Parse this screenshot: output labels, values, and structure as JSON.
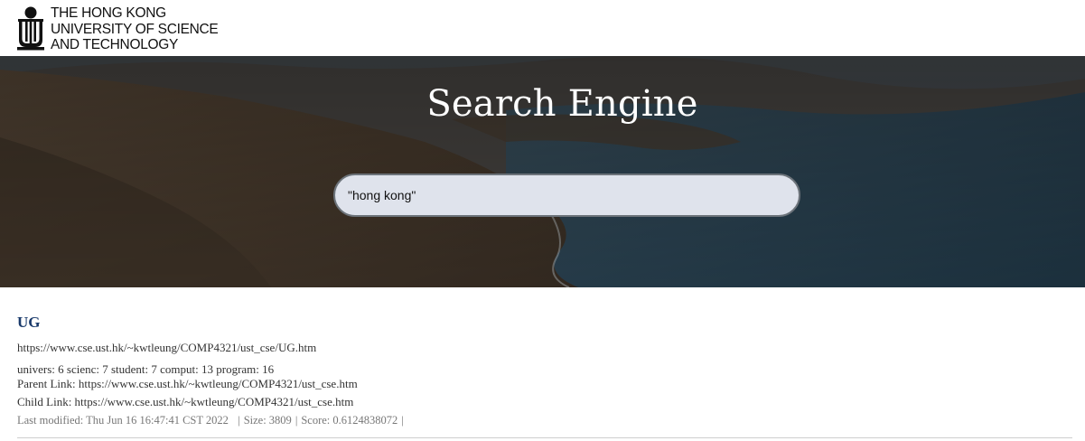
{
  "header": {
    "logo_line1": "THE HONG KONG",
    "logo_line2": "UNIVERSITY OF SCIENCE",
    "logo_line3": "AND TECHNOLOGY"
  },
  "hero": {
    "title": "Search Engine"
  },
  "search": {
    "value": "\"hong kong\""
  },
  "results": [
    {
      "title": "UG",
      "url": "https://www.cse.ust.hk/~kwtleung/COMP4321/ust_cse/UG.htm",
      "keywords": "univers: 6 scienc: 7 student: 7 comput: 13 program: 16",
      "parent_link": "Parent Link: https://www.cse.ust.hk/~kwtleung/COMP4321/ust_cse.htm",
      "child_link": "Child Link: https://www.cse.ust.hk/~kwtleung/COMP4321/ust_cse.htm",
      "last_modified": "Last modified:  Thu Jun 16 16:47:41 CST 2022",
      "size": "Size: 3809",
      "score": "Score: 0.6124838072"
    }
  ],
  "colors": {
    "result_title": "#1a3a6b",
    "search_bg": "#dfe3ec",
    "search_border": "#6c737a"
  }
}
